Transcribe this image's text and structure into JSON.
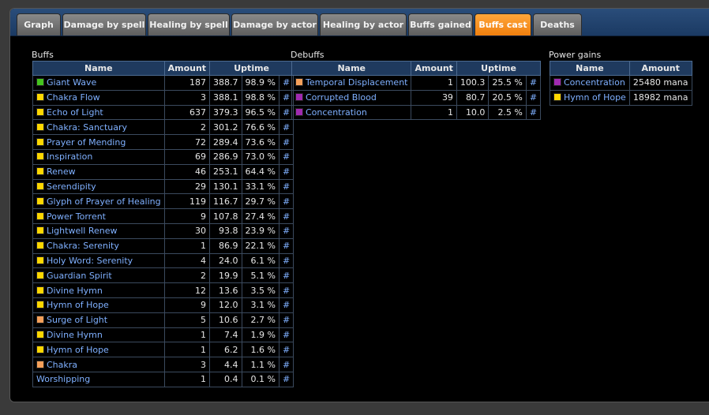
{
  "tabs": [
    {
      "label": "Graph",
      "active": false
    },
    {
      "label": "Damage by spell",
      "active": false
    },
    {
      "label": "Healing by spell",
      "active": false
    },
    {
      "label": "Damage by actor",
      "active": false
    },
    {
      "label": "Healing by actor",
      "active": false
    },
    {
      "label": "Buffs gained",
      "active": false
    },
    {
      "label": "Buffs cast",
      "active": true
    },
    {
      "label": "Deaths",
      "active": false
    }
  ],
  "buffs": {
    "title": "Buffs",
    "headers": {
      "name": "Name",
      "amount": "Amount",
      "uptime": "Uptime"
    },
    "rows": [
      {
        "name": "Giant Wave",
        "color": "#44c41e",
        "amount": "187",
        "secs": "388.7",
        "pct": "98.9 %",
        "hash": "#"
      },
      {
        "name": "Chakra Flow",
        "color": "#ffd700",
        "amount": "3",
        "secs": "388.1",
        "pct": "98.8 %",
        "hash": "#"
      },
      {
        "name": "Echo of Light",
        "color": "#ffd700",
        "amount": "637",
        "secs": "379.3",
        "pct": "96.5 %",
        "hash": "#"
      },
      {
        "name": "Chakra: Sanctuary",
        "color": "#ffd700",
        "amount": "2",
        "secs": "301.2",
        "pct": "76.6 %",
        "hash": "#"
      },
      {
        "name": "Prayer of Mending",
        "color": "#ffd700",
        "amount": "72",
        "secs": "289.4",
        "pct": "73.6 %",
        "hash": "#"
      },
      {
        "name": "Inspiration",
        "color": "#ffd700",
        "amount": "69",
        "secs": "286.9",
        "pct": "73.0 %",
        "hash": "#"
      },
      {
        "name": "Renew",
        "color": "#ffd700",
        "amount": "46",
        "secs": "253.1",
        "pct": "64.4 %",
        "hash": "#"
      },
      {
        "name": "Serendipity",
        "color": "#ffd700",
        "amount": "29",
        "secs": "130.1",
        "pct": "33.1 %",
        "hash": "#"
      },
      {
        "name": "Glyph of Prayer of Healing",
        "color": "#ffd700",
        "amount": "119",
        "secs": "116.7",
        "pct": "29.7 %",
        "hash": "#"
      },
      {
        "name": "Power Torrent",
        "color": "#ffd700",
        "amount": "9",
        "secs": "107.8",
        "pct": "27.4 %",
        "hash": "#"
      },
      {
        "name": "Lightwell Renew",
        "color": "#ffd700",
        "amount": "30",
        "secs": "93.8",
        "pct": "23.9 %",
        "hash": "#"
      },
      {
        "name": "Chakra: Serenity",
        "color": "#ffd700",
        "amount": "1",
        "secs": "86.9",
        "pct": "22.1 %",
        "hash": "#"
      },
      {
        "name": "Holy Word: Serenity",
        "color": "#ffd700",
        "amount": "4",
        "secs": "24.0",
        "pct": "6.1 %",
        "hash": "#"
      },
      {
        "name": "Guardian Spirit",
        "color": "#ffd700",
        "amount": "2",
        "secs": "19.9",
        "pct": "5.1 %",
        "hash": "#"
      },
      {
        "name": "Divine Hymn",
        "color": "#ffd700",
        "amount": "12",
        "secs": "13.6",
        "pct": "3.5 %",
        "hash": "#"
      },
      {
        "name": "Hymn of Hope",
        "color": "#ffd700",
        "amount": "9",
        "secs": "12.0",
        "pct": "3.1 %",
        "hash": "#"
      },
      {
        "name": "Surge of Light",
        "color": "#f5a05a",
        "amount": "5",
        "secs": "10.6",
        "pct": "2.7 %",
        "hash": "#"
      },
      {
        "name": "Divine Hymn",
        "color": "#ffd700",
        "amount": "1",
        "secs": "7.4",
        "pct": "1.9 %",
        "hash": "#"
      },
      {
        "name": "Hymn of Hope",
        "color": "#ffd700",
        "amount": "1",
        "secs": "6.2",
        "pct": "1.6 %",
        "hash": "#"
      },
      {
        "name": "Chakra",
        "color": "#f5a05a",
        "amount": "3",
        "secs": "4.4",
        "pct": "1.1 %",
        "hash": "#"
      },
      {
        "name": "Worshipping",
        "color": "",
        "amount": "1",
        "secs": "0.4",
        "pct": "0.1 %",
        "hash": "#"
      }
    ]
  },
  "debuffs": {
    "title": "Debuffs",
    "headers": {
      "name": "Name",
      "amount": "Amount",
      "uptime": "Uptime"
    },
    "rows": [
      {
        "name": "Temporal Displacement",
        "color": "#f5a05a",
        "amount": "1",
        "secs": "100.3",
        "pct": "25.5 %",
        "hash": "#"
      },
      {
        "name": "Corrupted Blood",
        "color": "#a02ab0",
        "amount": "39",
        "secs": "80.7",
        "pct": "20.5 %",
        "hash": "#"
      },
      {
        "name": "Concentration",
        "color": "#a02ab0",
        "amount": "1",
        "secs": "10.0",
        "pct": "2.5 %",
        "hash": "#"
      }
    ]
  },
  "power": {
    "title": "Power gains",
    "headers": {
      "name": "Name",
      "amount": "Amount"
    },
    "rows": [
      {
        "name": "Concentration",
        "color": "#a02ab0",
        "amount": "25480 mana"
      },
      {
        "name": "Hymn of Hope",
        "color": "#ffd700",
        "amount": "18982 mana"
      }
    ]
  }
}
